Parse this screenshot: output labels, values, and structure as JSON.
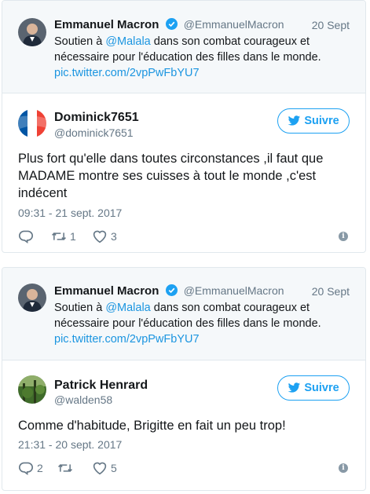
{
  "tweets": [
    {
      "quoted": {
        "name": "Emmanuel Macron",
        "handle": "@EmmanuelMacron",
        "date": "20 Sept",
        "text_before": "Soutien à ",
        "mention": "@Malala",
        "text_after": " dans son combat courageux et nécessaire pour l'éducation des filles dans le monde.",
        "link": "pic.twitter.com/2vpPwFbYU7"
      },
      "author": {
        "name": "Dominick7651",
        "handle": "@dominick7651",
        "avatar_icon": "french-flag-avatar"
      },
      "follow_label": "Suivre",
      "text": "Plus fort qu'elle dans toutes circonstances ,il faut que MADAME montre ses cuisses à tout le monde ,c'est indécent",
      "timestamp": "09:31 - 21 sept. 2017",
      "replies": "",
      "retweets": "1",
      "likes": "3"
    },
    {
      "quoted": {
        "name": "Emmanuel Macron",
        "handle": "@EmmanuelMacron",
        "date": "20 Sept",
        "text_before": "Soutien à ",
        "mention": "@Malala",
        "text_after": " dans son combat courageux et nécessaire pour l'éducation des filles dans le monde.",
        "link": "pic.twitter.com/2vpPwFbYU7"
      },
      "author": {
        "name": "Patrick Henrard",
        "handle": "@walden58",
        "avatar_icon": "forest-avatar"
      },
      "follow_label": "Suivre",
      "text": "Comme d'habitude, Brigitte en fait un peu trop!",
      "timestamp": "21:31 - 20 sept. 2017",
      "replies": "2",
      "retweets": "",
      "likes": "5"
    }
  ],
  "colors": {
    "accent": "#1da1f2",
    "link": "#1b95e0",
    "muted": "#657786",
    "quote_bg": "#f5f8fa",
    "border": "#e1e8ed"
  }
}
